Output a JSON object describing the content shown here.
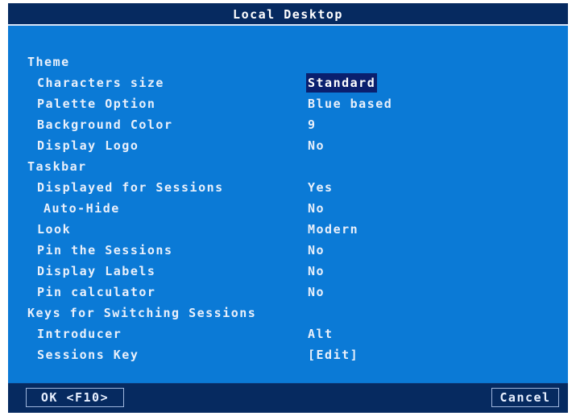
{
  "window": {
    "title": "Local Desktop"
  },
  "settings": {
    "theme_header": "Theme",
    "characters_size_label": "Characters size",
    "characters_size_value": "Standard",
    "palette_option_label": "Palette Option",
    "palette_option_value": "Blue based",
    "background_color_label": "Background Color",
    "background_color_value": "9",
    "display_logo_label": "Display Logo",
    "display_logo_value": "No",
    "taskbar_header": "Taskbar",
    "displayed_for_sessions_label": "Displayed for Sessions",
    "displayed_for_sessions_value": "Yes",
    "auto_hide_label": "Auto-Hide",
    "auto_hide_value": "No",
    "look_label": "Look",
    "look_value": "Modern",
    "pin_sessions_label": "Pin the Sessions",
    "pin_sessions_value": "No",
    "display_labels_label": "Display Labels",
    "display_labels_value": "No",
    "pin_calculator_label": "Pin calculator",
    "pin_calculator_value": "No",
    "keys_header": "Keys for Switching Sessions",
    "introducer_label": "Introducer",
    "introducer_value": "Alt",
    "sessions_key_label": "Sessions Key",
    "sessions_key_value": "[Edit]"
  },
  "footer": {
    "ok_label": "OK <F10>",
    "cancel_label": "Cancel"
  },
  "colors": {
    "panel": "#0b7ad6",
    "titlebar": "#062a60",
    "selection": "#0a1f6e",
    "text": "#e9f0fb"
  }
}
